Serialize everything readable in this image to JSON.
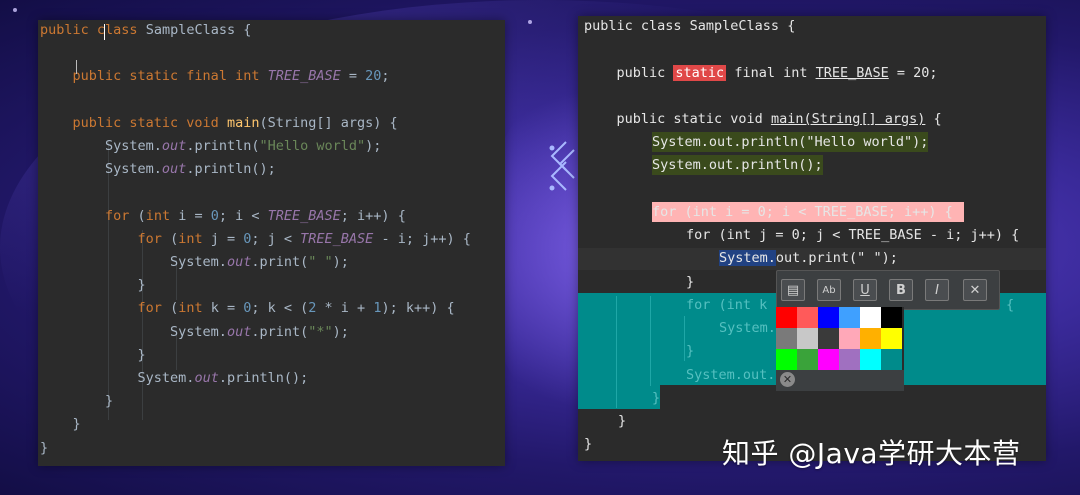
{
  "left_editor": {
    "lines": [
      {
        "parts": [
          [
            "kw",
            "public"
          ],
          [
            "plain",
            " "
          ],
          [
            "kw",
            "class"
          ],
          [
            "plain",
            " SampleClass {"
          ]
        ]
      },
      {
        "parts": []
      },
      {
        "parts": [
          [
            "plain",
            "    "
          ],
          [
            "kw",
            "public static final int"
          ],
          [
            "plain",
            " "
          ],
          [
            "field",
            "TREE_BASE"
          ],
          [
            "plain",
            " = "
          ],
          [
            "num",
            "20"
          ],
          [
            "plain",
            ";"
          ]
        ]
      },
      {
        "parts": []
      },
      {
        "parts": [
          [
            "plain",
            "    "
          ],
          [
            "kw",
            "public static void"
          ],
          [
            "plain",
            " "
          ],
          [
            "fn",
            "main"
          ],
          [
            "plain",
            "(String[] args) {"
          ]
        ]
      },
      {
        "parts": [
          [
            "plain",
            "        System."
          ],
          [
            "field",
            "out"
          ],
          [
            "plain",
            ".println("
          ],
          [
            "str",
            "\"Hello world\""
          ],
          [
            "plain",
            ");"
          ]
        ]
      },
      {
        "parts": [
          [
            "plain",
            "        System."
          ],
          [
            "field",
            "out"
          ],
          [
            "plain",
            ".println();"
          ]
        ]
      },
      {
        "parts": []
      },
      {
        "parts": [
          [
            "plain",
            "        "
          ],
          [
            "kw",
            "for"
          ],
          [
            "plain",
            " ("
          ],
          [
            "kw",
            "int"
          ],
          [
            "plain",
            " i = "
          ],
          [
            "num",
            "0"
          ],
          [
            "plain",
            "; i < "
          ],
          [
            "field",
            "TREE_BASE"
          ],
          [
            "plain",
            "; i++) {"
          ]
        ]
      },
      {
        "parts": [
          [
            "plain",
            "            "
          ],
          [
            "kw",
            "for"
          ],
          [
            "plain",
            " ("
          ],
          [
            "kw",
            "int"
          ],
          [
            "plain",
            " j = "
          ],
          [
            "num",
            "0"
          ],
          [
            "plain",
            "; j < "
          ],
          [
            "field",
            "TREE_BASE"
          ],
          [
            "plain",
            " - i; j++) {"
          ]
        ]
      },
      {
        "parts": [
          [
            "plain",
            "                System."
          ],
          [
            "field",
            "out"
          ],
          [
            "plain",
            ".print("
          ],
          [
            "str",
            "\" \""
          ],
          [
            "plain",
            ");"
          ]
        ]
      },
      {
        "parts": [
          [
            "plain",
            "            }"
          ]
        ]
      },
      {
        "parts": [
          [
            "plain",
            "            "
          ],
          [
            "kw",
            "for"
          ],
          [
            "plain",
            " ("
          ],
          [
            "kw",
            "int"
          ],
          [
            "plain",
            " k = "
          ],
          [
            "num",
            "0"
          ],
          [
            "plain",
            "; k < ("
          ],
          [
            "num",
            "2"
          ],
          [
            "plain",
            " * i + "
          ],
          [
            "num",
            "1"
          ],
          [
            "plain",
            "); k++) {"
          ]
        ]
      },
      {
        "parts": [
          [
            "plain",
            "                System."
          ],
          [
            "field",
            "out"
          ],
          [
            "plain",
            ".print("
          ],
          [
            "str",
            "\"*\""
          ],
          [
            "plain",
            ");"
          ]
        ]
      },
      {
        "parts": [
          [
            "plain",
            "            }"
          ]
        ]
      },
      {
        "parts": [
          [
            "plain",
            "            System."
          ],
          [
            "field",
            "out"
          ],
          [
            "plain",
            ".println();"
          ]
        ]
      },
      {
        "parts": [
          [
            "plain",
            "        }"
          ]
        ]
      },
      {
        "parts": [
          [
            "plain",
            "    }"
          ]
        ]
      },
      {
        "parts": [
          [
            "plain",
            "}"
          ]
        ]
      }
    ]
  },
  "right_editor": {
    "line_class_name": "public class SampleClass {",
    "line_field_a": "    public ",
    "line_field_static": "static",
    "line_field_b": " final int ",
    "line_field_name": "TREE_BASE",
    "line_field_c": " = 20;",
    "line_main_a": "    public static void ",
    "line_main_sig": "main(String[] args)",
    "line_main_b": " {",
    "line_println1": "System.out.println(\"Hello world\");",
    "line_println2": "System.out.println();",
    "line_for_i": "for (int i = 0; i < TREE_BASE; i++) {",
    "line_for_j": "for (int j = 0; j < TREE_BASE - i; j++) {",
    "line_print_space_a": "System.",
    "line_print_space_b": "out.print(\" \");",
    "line_close_j": "}",
    "line_for_k_a": "for (int k",
    "line_for_k_b": "{",
    "line_print_star_a": "System.",
    "line_close_k": "}",
    "line_println3_a": "System.out.",
    "line_close_i": "}",
    "line_close_main": "}",
    "line_close_class": "}"
  },
  "format_toolbar": {
    "buttons": [
      {
        "name": "paste-icon",
        "glyph": "▤"
      },
      {
        "name": "abbreviate-icon",
        "glyph": "Ab"
      },
      {
        "name": "underline-icon",
        "glyph": "U"
      },
      {
        "name": "bold-icon",
        "glyph": "B"
      },
      {
        "name": "italic-icon",
        "glyph": "I"
      },
      {
        "name": "close-icon",
        "glyph": "✕"
      }
    ],
    "colors": [
      [
        "#ff0000",
        "#ff5a5a",
        "#0000ff",
        "#3fa0ff",
        "#ffffff",
        "#000000"
      ],
      [
        "#7a7a7a",
        "#c8c8c8",
        "#3a3a3a",
        "#ffa8b8",
        "#ffb000",
        "#ffff00"
      ],
      [
        "#00ff00",
        "#3aa33a",
        "#ff00ff",
        "#a070c0",
        "#00ffff",
        "#008b8b"
      ]
    ],
    "clear_glyph": "✕"
  },
  "watermark": "知乎 @Java学研大本营"
}
